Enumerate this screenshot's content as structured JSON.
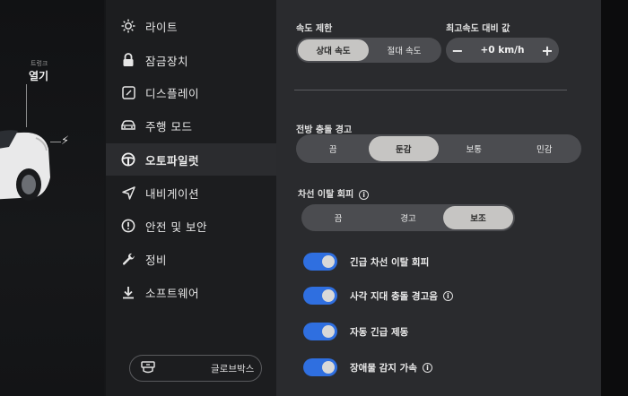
{
  "car": {
    "trunk_small": "트렁크",
    "trunk_open": "열기"
  },
  "menu": {
    "items": [
      {
        "label": "라이트",
        "icon": "sun-icon"
      },
      {
        "label": "잠금장치",
        "icon": "lock-icon"
      },
      {
        "label": "디스플레이",
        "icon": "display-icon"
      },
      {
        "label": "주행 모드",
        "icon": "car-icon"
      },
      {
        "label": "오토파일럿",
        "icon": "steering-wheel-icon",
        "active": true
      },
      {
        "label": "내비게이션",
        "icon": "navigation-icon"
      },
      {
        "label": "안전 및 보안",
        "icon": "alert-icon"
      },
      {
        "label": "정비",
        "icon": "wrench-icon"
      },
      {
        "label": "소프트웨어",
        "icon": "download-icon"
      }
    ],
    "glovebox": "글로브박스"
  },
  "speed_limit": {
    "label": "속도 제한",
    "options": [
      "상대 속도",
      "절대 속도"
    ],
    "selected": "상대 속도"
  },
  "offset": {
    "label": "최고속도 대비 값",
    "minus": "−",
    "plus": "+",
    "value": "+0 km/h"
  },
  "fcw": {
    "label": "전방 충돌 경고",
    "options": [
      "끔",
      "둔감",
      "보통",
      "민감"
    ],
    "selected": "둔감"
  },
  "lane": {
    "label": "차선 이탈 회피",
    "info": "i",
    "options": [
      "끔",
      "경고",
      "보조"
    ],
    "selected": "보조"
  },
  "toggles": [
    {
      "label": "긴급 차선 이탈 회피",
      "on": true,
      "info": ""
    },
    {
      "label": "사각 지대 충돌 경고음",
      "on": true,
      "info": "i"
    },
    {
      "label": "자동 긴급 제동",
      "on": true,
      "info": ""
    },
    {
      "label": "장애물 감지 가속",
      "on": true,
      "info": "i"
    }
  ],
  "colors": {
    "toggle_on": "#2f6fe0",
    "selected_segment": "#c6c5c3"
  }
}
